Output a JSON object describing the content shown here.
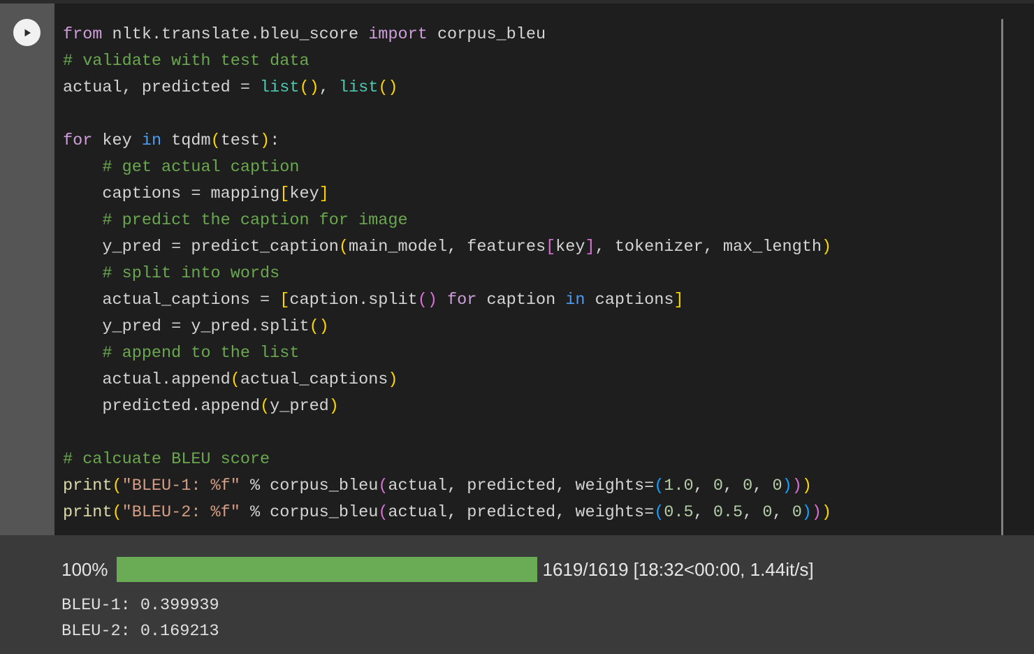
{
  "cell": {
    "run_button_icon": "play-icon",
    "language": "python"
  },
  "code": {
    "lines": [
      "from nltk.translate.bleu_score import corpus_bleu",
      "# validate with test data",
      "actual, predicted = list(), list()",
      "",
      "for key in tqdm(test):",
      "    # get actual caption",
      "    captions = mapping[key]",
      "    # predict the caption for image",
      "    y_pred = predict_caption(main_model, features[key], tokenizer, max_length)",
      "    # split into words",
      "    actual_captions = [caption.split() for caption in captions]",
      "    y_pred = y_pred.split()",
      "    # append to the list",
      "    actual.append(actual_captions)",
      "    predicted.append(y_pred)",
      "",
      "# calcuate BLEU score",
      "print(\"BLEU-1: %f\" % corpus_bleu(actual, predicted, weights=(1.0, 0, 0, 0)))",
      "print(\"BLEU-2: %f\" % corpus_bleu(actual, predicted, weights=(0.5, 0.5, 0, 0)))"
    ],
    "tokens": {
      "kw_from": "from",
      "module_path": "nltk.translate.bleu_score",
      "kw_import": "import",
      "imported_name": "corpus_bleu",
      "comment_validate": "# validate with test data",
      "assign_actual_predicted": "actual, predicted = ",
      "builtin_list": "list",
      "kw_for": "for",
      "var_key": "key",
      "kw_in": "in",
      "fn_tqdm": "tqdm",
      "var_test": "test",
      "comment_get_actual": "# get actual caption",
      "var_captions": "captions = mapping",
      "comment_predict": "# predict the caption for image",
      "comment_split": "# split into words",
      "comment_append": "# append to the list",
      "comment_calculate": "# calcuate BLEU score",
      "fn_print": "print",
      "str_bleu1": "\"BLEU-1: %f\"",
      "str_bleu2": "\"BLEU-2: %f\"",
      "fn_corpus_bleu": "corpus_bleu",
      "weights_kw": "weights=",
      "w1": [
        "1.0",
        "0",
        "0",
        "0"
      ],
      "w2": [
        "0.5",
        "0.5",
        "0",
        "0"
      ]
    },
    "colors": {
      "background": "#1e1e1e",
      "gutter": "#555555",
      "default_text": "#d4d4d4",
      "keyword": "#d09edb",
      "keyword_in": "#4b9cf5",
      "comment": "#6aa84f",
      "builtin": "#4ec9b0",
      "function": "#dcdcaa",
      "string": "#d69d85",
      "number": "#b5cea8",
      "bracket_depth1": "#ffd700",
      "bracket_depth2": "#da70d6",
      "bracket_depth3": "#179fff"
    }
  },
  "output": {
    "background": "#3a3a3a",
    "progress": {
      "percent_label": "100%",
      "percent_value": 100,
      "bar_color": "#6aab56",
      "stats": "1619/1619 [18:32<00:00, 1.44it/s]",
      "current": 1619,
      "total": 1619,
      "elapsed": "18:32",
      "remaining": "00:00",
      "rate": "1.44it/s"
    },
    "results": [
      "BLEU-1: 0.399939",
      "BLEU-2: 0.169213"
    ],
    "bleu1_label": "BLEU-1:",
    "bleu1_value": "0.399939",
    "bleu2_label": "BLEU-2:",
    "bleu2_value": "0.169213"
  }
}
